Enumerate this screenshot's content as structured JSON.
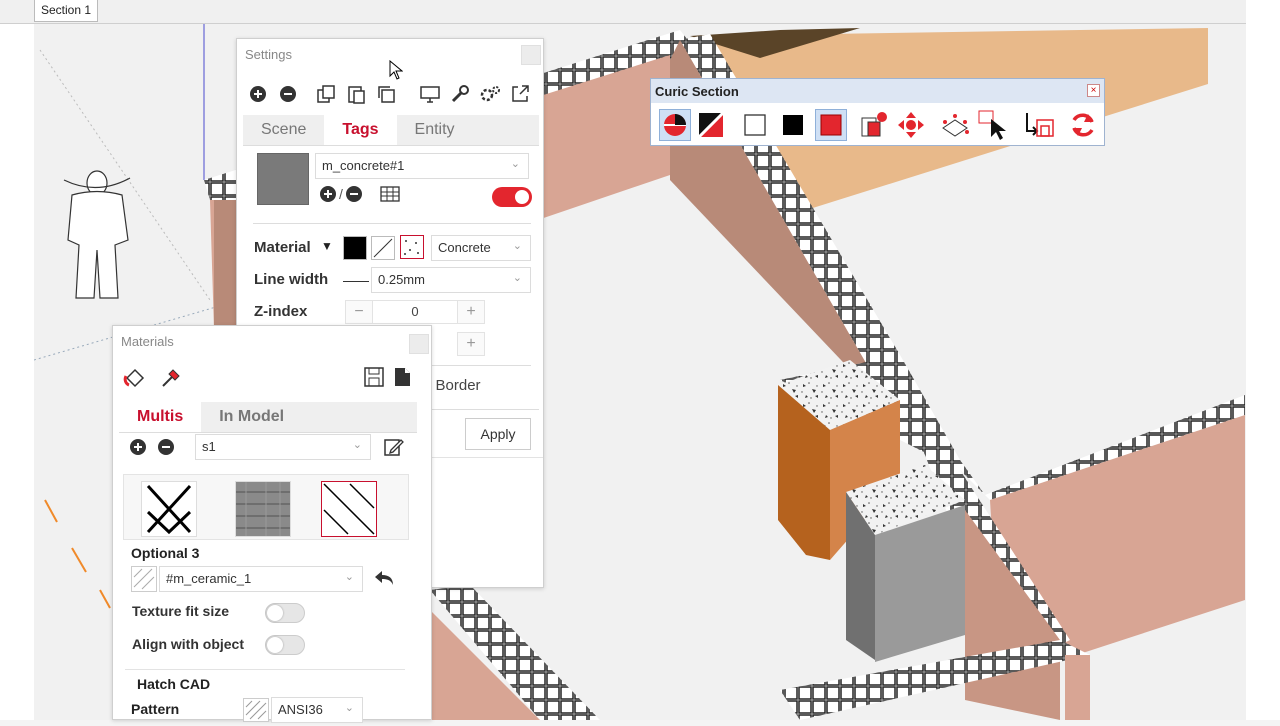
{
  "scene_tabs": [
    "Section 1"
  ],
  "settings": {
    "title": "Settings",
    "toolbar_icons": [
      "add-icon",
      "remove-icon",
      "copy-icon",
      "paste-icon",
      "duplicate-icon",
      "monitor-icon",
      "wrench-icon",
      "gears-icon",
      "export-icon"
    ],
    "tabs": [
      "Scene",
      "Tags",
      "Entity"
    ],
    "active_tab": "Tags",
    "tag_name": "m_concrete#1",
    "add_remove_sep": "/",
    "tag_enabled": true,
    "material_label": "Material",
    "material_value": "Concrete",
    "line_width_label": "Line width",
    "line_width_value": "0.25mm",
    "zindex_label": "Z-index",
    "zindex_value": "0",
    "stepper_minus": "−",
    "stepper_plus": "+",
    "border_label": "e Border",
    "apply_label": "Apply"
  },
  "curic": {
    "title": "Curic Section",
    "close": "×",
    "buttons": [
      "section-plane-icon",
      "hatch-toggle-icon",
      "white-fill-icon",
      "black-fill-icon",
      "red-fill-icon",
      "section-display-icon",
      "move-section-icon",
      "section-box-icon",
      "select-section-icon",
      "reverse-section-icon",
      "refresh-icon"
    ]
  },
  "materials": {
    "title": "Materials",
    "tabs": [
      "Multis",
      "In Model"
    ],
    "active_tab": "Multis",
    "set_name": "s1",
    "optional_label": "Optional 3",
    "texture_name": "#m_ceramic_1",
    "texture_fit_label": "Texture fit size",
    "align_label": "Align with object",
    "hatch_label": "Hatch CAD",
    "pattern_label": "Pattern",
    "pattern_value": "ANSI36"
  },
  "colors": {
    "accent": "#e3262e",
    "wall": "#d8a594",
    "floor_top": "#e8b98a",
    "column_orange": "#c8743a",
    "column_gray": "#8a8a8a"
  }
}
